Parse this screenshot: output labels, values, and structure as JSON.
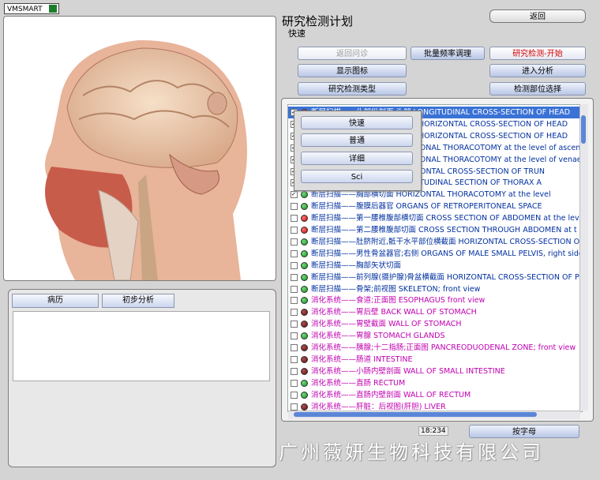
{
  "app": {
    "logo_text": "VMSMART"
  },
  "header": {
    "title": "研究检测计划",
    "subtitle": "快速"
  },
  "buttons": {
    "back": "返回",
    "back_to_consult": "返回问诊",
    "batch_freq": "批量频率调理",
    "start_research": "研究检测-开始",
    "show_icon": "显示图标",
    "enter_analysis": "进入分析",
    "research_type": "研究检测类型",
    "select_part": "检测部位选择",
    "sort_letter": "按字母"
  },
  "popup": {
    "items": [
      "快速",
      "普通",
      "详细",
      "Sci"
    ]
  },
  "list": {
    "rows": [
      {
        "checked": true,
        "dot": "red",
        "color": "blue",
        "text": "断层扫描——头部纵剖面 头部 LONGITUDINAL CROSS-SECTION OF HEAD",
        "selected": true
      },
      {
        "checked": true,
        "dot": "red",
        "color": "blue",
        "text": "断层扫描——头部横切面上部位 HORIZONTAL CROSS-SECTION OF HEAD"
      },
      {
        "checked": true,
        "dot": "red",
        "color": "blue",
        "text": "断层扫描——头部横切面下部位 HORIZONTAL CROSS-SECTION OF HEAD"
      },
      {
        "checked": true,
        "dot": "green",
        "color": "blue",
        "text": "断层扫描——冠状胸部切面 CORONAL THORACOTOMY at the level of ascen"
      },
      {
        "checked": true,
        "dot": "green",
        "color": "blue",
        "text": "断层扫描——冠状胸部切面 CORONAL THORACOTOMY at the level of venae"
      },
      {
        "checked": true,
        "dot": "green",
        "color": "blue",
        "text": "断层扫描——躯干横切面 HORIZONTAL CROSS-SECTION OF TRUN"
      },
      {
        "checked": true,
        "dot": "green",
        "color": "blue",
        "text": "断层扫描——胸腹纵切面 LONGITUDINAL SECTION OF THORAX A"
      },
      {
        "checked": true,
        "dot": "green",
        "color": "blue",
        "text": "断层扫描——胸部横切面 HORIZONTAL THORACOTOMY at the level"
      },
      {
        "checked": false,
        "dot": "green",
        "color": "blue",
        "text": "断层扫描——腹膜后器官 ORGANS OF RETROPERITONEAL SPACE"
      },
      {
        "checked": false,
        "dot": "red",
        "color": "blue",
        "text": "断层扫描——第一腰椎腹部横切面 CROSS SECTION OF ABDOMEN at the level"
      },
      {
        "checked": false,
        "dot": "red",
        "color": "blue",
        "text": "断层扫描——第二腰椎腹部切面 CROSS SECTION THROUGH ABDOMEN at t"
      },
      {
        "checked": false,
        "dot": "green",
        "color": "blue",
        "text": "断层扫描——肚脐附近,骶干水平部位横截面 HORIZONTAL CROSS-SECTION O"
      },
      {
        "checked": false,
        "dot": "green",
        "color": "blue",
        "text": "断层扫描——男性骨盆器官;右侧 ORGANS OF MALE SMALL PELVIS, right side"
      },
      {
        "checked": false,
        "dot": "green",
        "color": "blue",
        "text": "断层扫描——胸部矢状切面"
      },
      {
        "checked": false,
        "dot": "green",
        "color": "blue",
        "text": "断层扫描——前列腺(摄护腺)骨盆横截面 HORIZONTAL CROSS-SECTION OF PE"
      },
      {
        "checked": false,
        "dot": "green",
        "color": "blue",
        "text": "断层扫描——骨架;前视图 SKELETON;  front  view"
      },
      {
        "checked": false,
        "dot": "green",
        "color": "mag",
        "text": "消化系统——食道;正面图 ESOPHAGUS    front  view"
      },
      {
        "checked": false,
        "dot": "darkred",
        "color": "mag",
        "text": "消化系统——胃后壁 BACK WALL OF STOMACH"
      },
      {
        "checked": false,
        "dot": "darkred",
        "color": "mag",
        "text": "消化系统——胃壁截面 WALL OF STOMACH"
      },
      {
        "checked": false,
        "dot": "green",
        "color": "mag",
        "text": "消化系统——胃腺 STOMACH  GLANDS"
      },
      {
        "checked": false,
        "dot": "darkred",
        "color": "mag",
        "text": "消化系统——胰腺;十二指肠;正面图 PANCREODUODENAL  ZONE;  front  view"
      },
      {
        "checked": false,
        "dot": "darkred",
        "color": "mag",
        "text": "消化系统——肠道 INTESTINE"
      },
      {
        "checked": false,
        "dot": "darkred",
        "color": "mag",
        "text": "消化系统——小肠内壁剖面 WALL  OF  SMALL  INTESTINE"
      },
      {
        "checked": false,
        "dot": "green",
        "color": "mag",
        "text": "消化系统——直肠 RECTUM"
      },
      {
        "checked": false,
        "dot": "green",
        "color": "mag",
        "text": "消化系统——直肠内壁剖面 WALL  OF  RECTUM"
      },
      {
        "checked": false,
        "dot": "darkred",
        "color": "mag",
        "text": "消化系统——肝脏：后视图(肝胆) LIVER"
      }
    ]
  },
  "history": {
    "tab_record": "病历",
    "tab_analysis": "初步分析"
  },
  "status": {
    "timestamp": "18:234"
  },
  "watermark": "广州薇妍生物科技有限公司"
}
